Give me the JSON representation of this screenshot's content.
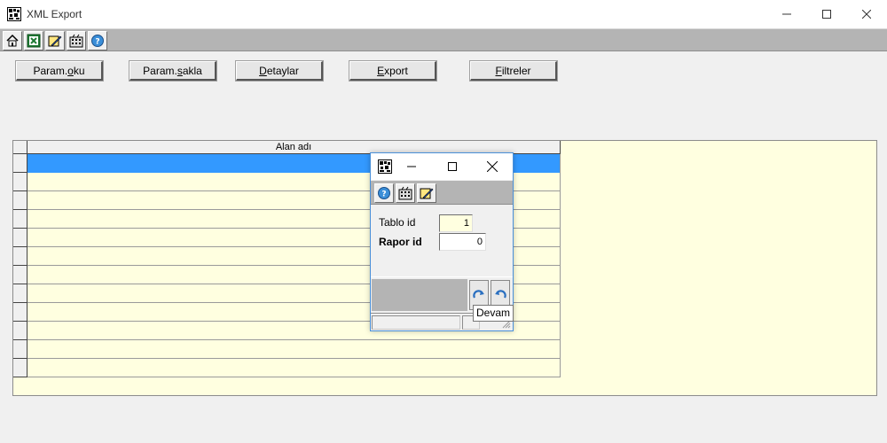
{
  "window": {
    "title": "XML Export",
    "icon": "app-grid-icon"
  },
  "toolbar": {
    "buttons": [
      "home-icon",
      "excel-icon",
      "edit-icon",
      "calculator-icon",
      "help-icon"
    ]
  },
  "actions": {
    "param_oku_prefix": "Param.",
    "param_oku_u": "o",
    "param_oku_suffix": "ku",
    "param_sakla_prefix": "Param.",
    "param_sakla_u": "s",
    "param_sakla_suffix": "akla",
    "detaylar_u": "D",
    "detaylar_suffix": "etaylar",
    "export_u": "E",
    "export_suffix": "xport",
    "filtreler_u": "F",
    "filtreler_suffix": "iltreler"
  },
  "grid": {
    "column_header": "Alan adı",
    "row_count": 12,
    "selected_row": 0,
    "background": "#ffffe0",
    "selection_color": "#3399ff"
  },
  "dialog": {
    "toolbar_buttons": [
      "help-icon",
      "calculator-icon",
      "edit-icon"
    ],
    "tablo_id_label": "Tablo id",
    "tablo_id_value": "1",
    "rapor_id_label": "Rapor id",
    "rapor_id_value": "0",
    "nav_buttons": [
      "redo-icon",
      "undo-icon"
    ]
  },
  "tooltip": {
    "text": "Devam"
  }
}
